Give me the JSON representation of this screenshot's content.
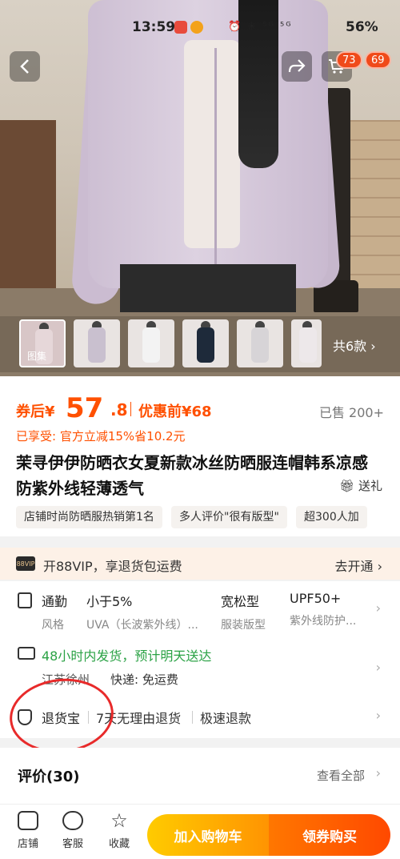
{
  "status_bar": {
    "time": "13:59",
    "network_icons": "⏰ ✳ ⁵ᴳ ⁵ᴳ",
    "battery": "56%"
  },
  "gallery": {
    "cart_badge": "73",
    "message_badge": "69",
    "first_thumb_label": "图集",
    "more_styles": "共6款 ›"
  },
  "price": {
    "prefix": "券后¥",
    "integer": "57",
    "decimal": ".8",
    "before_label": "优惠前¥68",
    "sold": "已售 200+",
    "discount_line": "已享受: 官方立减15%省10.2元"
  },
  "product": {
    "title": "茉寻伊伊防晒衣女夏新款冰丝防晒服连帽韩系凉感防紫外线轻薄透气",
    "gift": "送礼",
    "tags": [
      "店铺时尚防晒服热销第1名",
      "多人评价\"很有版型\"",
      "超300人加"
    ]
  },
  "vip": {
    "logo": "88VIP",
    "text": "开88VIP，享退货包运费",
    "link": "去开通 ›"
  },
  "attributes": [
    {
      "value": "通勤",
      "key": "风格"
    },
    {
      "value": "小于5%",
      "key": "UVA（长波紫外线）..."
    },
    {
      "value": "宽松型",
      "key": "服装版型"
    },
    {
      "value": "UPF50+",
      "key": "紫外线防护..."
    }
  ],
  "shipping": {
    "title": "48小时内发货，预计明天送达",
    "origin": "江苏徐州",
    "fee": "快递: 免运费"
  },
  "returns": {
    "name": "退货宝",
    "items": [
      "7天无理由退货",
      "极速退款"
    ]
  },
  "reviews": {
    "title": "评价(30)",
    "view_all": "查看全部"
  },
  "bottom_bar": {
    "store": "店铺",
    "service": "客服",
    "favorite": "收藏",
    "add_to_cart": "加入购物车",
    "buy_now": "领券购买"
  },
  "colors": {
    "accent": "#ff5000",
    "ship_green": "#2ba245",
    "annotation": "#e82a2a"
  }
}
